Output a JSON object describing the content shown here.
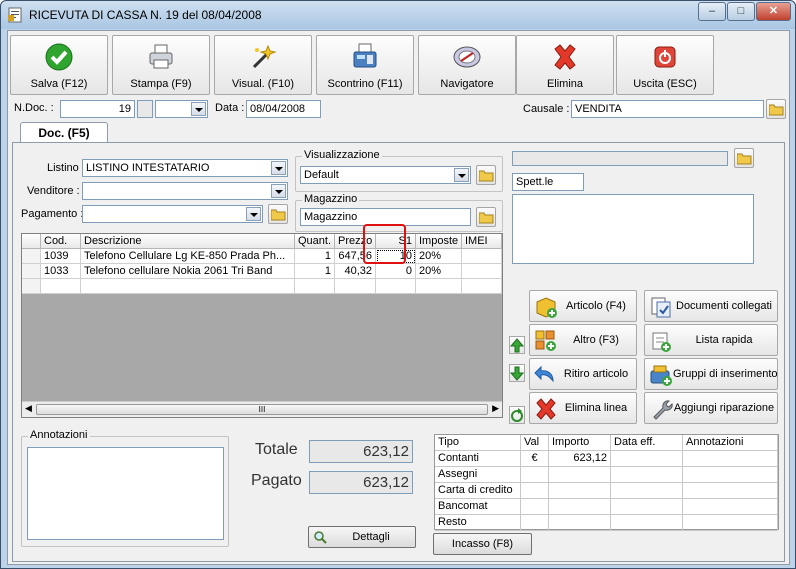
{
  "window": {
    "title": "RICEVUTA DI CASSA N. 19  del 08/04/2008",
    "minimize": "‒",
    "maximize": "□",
    "close": "✕"
  },
  "toolbar": [
    {
      "label": "Salva (F12)",
      "icon": "check-icon"
    },
    {
      "label": "Stampa (F9)",
      "icon": "printer-icon"
    },
    {
      "label": "Visual. (F10)",
      "icon": "magic-wand-icon"
    },
    {
      "label": "Scontrino (F11)",
      "icon": "cash-register-icon"
    },
    {
      "label": "Navigatore",
      "icon": "compass-icon"
    },
    {
      "label": "Elimina",
      "icon": "delete-x-icon"
    },
    {
      "label": "Uscita (ESC)",
      "icon": "power-icon"
    }
  ],
  "header": {
    "ndoc_label": "N.Doc. :",
    "ndoc_value": "19",
    "data_label": "Data :",
    "data_value": "08/04/2008",
    "causale_label": "Causale :",
    "causale_value": "VENDITA"
  },
  "tab": {
    "label": "Doc. (F5)"
  },
  "form": {
    "listino_label": "Listino :",
    "listino_value": "LISTINO INTESTATARIO",
    "venditore_label": "Venditore :",
    "venditore_value": "",
    "pagamento_label": "Pagamento :",
    "pagamento_value": "",
    "visualizzazione_title": "Visualizzazione",
    "visualizzazione_value": "Default",
    "magazzino_title": "Magazzino",
    "magazzino_value": "Magazzino",
    "cliente_value": "",
    "spett_value": "Spett.le",
    "indirizzo_value": ""
  },
  "grid": {
    "columns": [
      "Cod.",
      "Descrizione",
      "Quant.",
      "Prezzo",
      "S1",
      "Imposte",
      "IMEI"
    ],
    "rows": [
      {
        "cod": "1039",
        "descrizione": "Telefono Cellulare Lg KE-850 Prada Ph...",
        "quant": "1",
        "prezzo": "647,56",
        "s1": "10",
        "imposte": "20%",
        "imei": ""
      },
      {
        "cod": "1033",
        "descrizione": "Telefono cellulare Nokia 2061 Tri Band",
        "quant": "1",
        "prezzo": "40,32",
        "s1": "0",
        "imposte": "20%",
        "imei": ""
      }
    ],
    "scroll_thumb": "III"
  },
  "actions": [
    {
      "label": "Articolo (F4)",
      "icon": "box-add-icon"
    },
    {
      "label": "Documenti collegati",
      "icon": "linked-documents-icon"
    },
    {
      "label": "Altro (F3)",
      "icon": "grid-add-icon"
    },
    {
      "label": "Lista rapida",
      "icon": "quick-list-icon"
    },
    {
      "label": "Ritiro articolo",
      "icon": "return-arrow-icon"
    },
    {
      "label": "Gruppi di inserimento",
      "icon": "group-insert-icon"
    },
    {
      "label": "Elimina linea",
      "icon": "delete-line-icon"
    },
    {
      "label": "Aggiungi riparazione",
      "icon": "wrench-icon"
    }
  ],
  "annotazioni": {
    "title": "Annotazioni",
    "value": ""
  },
  "totals": {
    "totale_label": "Totale",
    "totale_value": "623,12",
    "pagato_label": "Pagato",
    "pagato_value": "623,12",
    "dettagli_label": "Dettagli"
  },
  "payments": {
    "columns": [
      "Tipo",
      "Val",
      "Importo",
      "Data eff.",
      "Annotazioni"
    ],
    "rows": [
      {
        "tipo": "Contanti",
        "val": "€",
        "importo": "623,12",
        "data": "",
        "note": ""
      },
      {
        "tipo": "Assegni",
        "val": "",
        "importo": "",
        "data": "",
        "note": ""
      },
      {
        "tipo": "Carta di credito",
        "val": "",
        "importo": "",
        "data": "",
        "note": ""
      },
      {
        "tipo": "Bancomat",
        "val": "",
        "importo": "",
        "data": "",
        "note": ""
      },
      {
        "tipo": "Resto",
        "val": "",
        "importo": "",
        "data": "",
        "note": ""
      }
    ],
    "incasso_label": "Incasso (F8)"
  },
  "colors": {
    "highlight": "#e01010",
    "accent": "#3a6ea5"
  }
}
